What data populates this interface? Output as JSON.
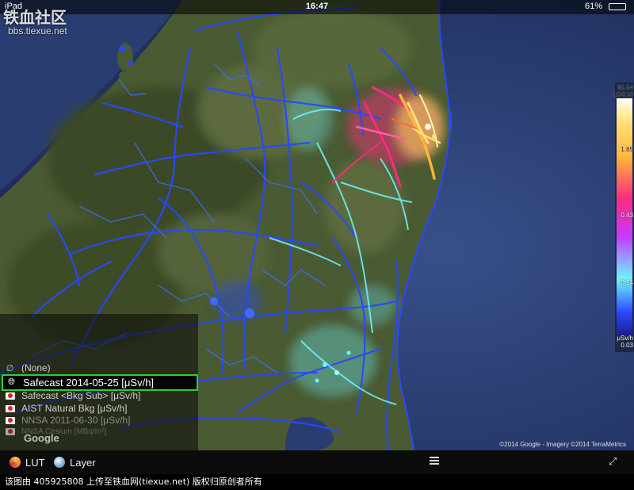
{
  "status_bar": {
    "device": "iPad",
    "time": "16:47",
    "battery": "61%"
  },
  "watermark": {
    "logo": "铁血社区",
    "url": "bbs.tiexue.net"
  },
  "legend": {
    "labels": [
      "65.54",
      "LOG10",
      "1.65",
      "0.43",
      "0.14",
      "μSv/h",
      "0.03"
    ]
  },
  "layer_menu": {
    "items": [
      {
        "label": "(None)",
        "icon": "none-icon"
      },
      {
        "label": "Safecast 2014-05-25 [μSv/h]",
        "icon": "globe-icon",
        "selected": true
      },
      {
        "label": "Safecast <Bkg Sub> [μSv/h]",
        "icon": "japan-flag-icon"
      },
      {
        "label": "AIST Natural Bkg [μSv/h]",
        "icon": "japan-flag-icon"
      },
      {
        "label": "NNSA 2011-06-30 [μSv/h]",
        "icon": "japan-flag-icon"
      },
      {
        "label": "NNSA Cesium [MBq/m²]",
        "icon": "japan-flag-icon"
      }
    ]
  },
  "map": {
    "google_logo": "Google",
    "attribution": "©2014 Google - Imagery ©2014 TerraMetrics"
  },
  "toolbar": {
    "lut_label": "LUT",
    "layer_label": "Layer"
  },
  "footer": {
    "text": "该图由 405925808 上传至铁血网(tiexue.net) 版权归原创者所有"
  },
  "colors": {
    "selected_outline": "#2ecc40",
    "road_low": "#2a48ff",
    "road_mid": "#6ef6ff",
    "road_high": "#ff2a80",
    "road_peak": "#ffe27a"
  }
}
